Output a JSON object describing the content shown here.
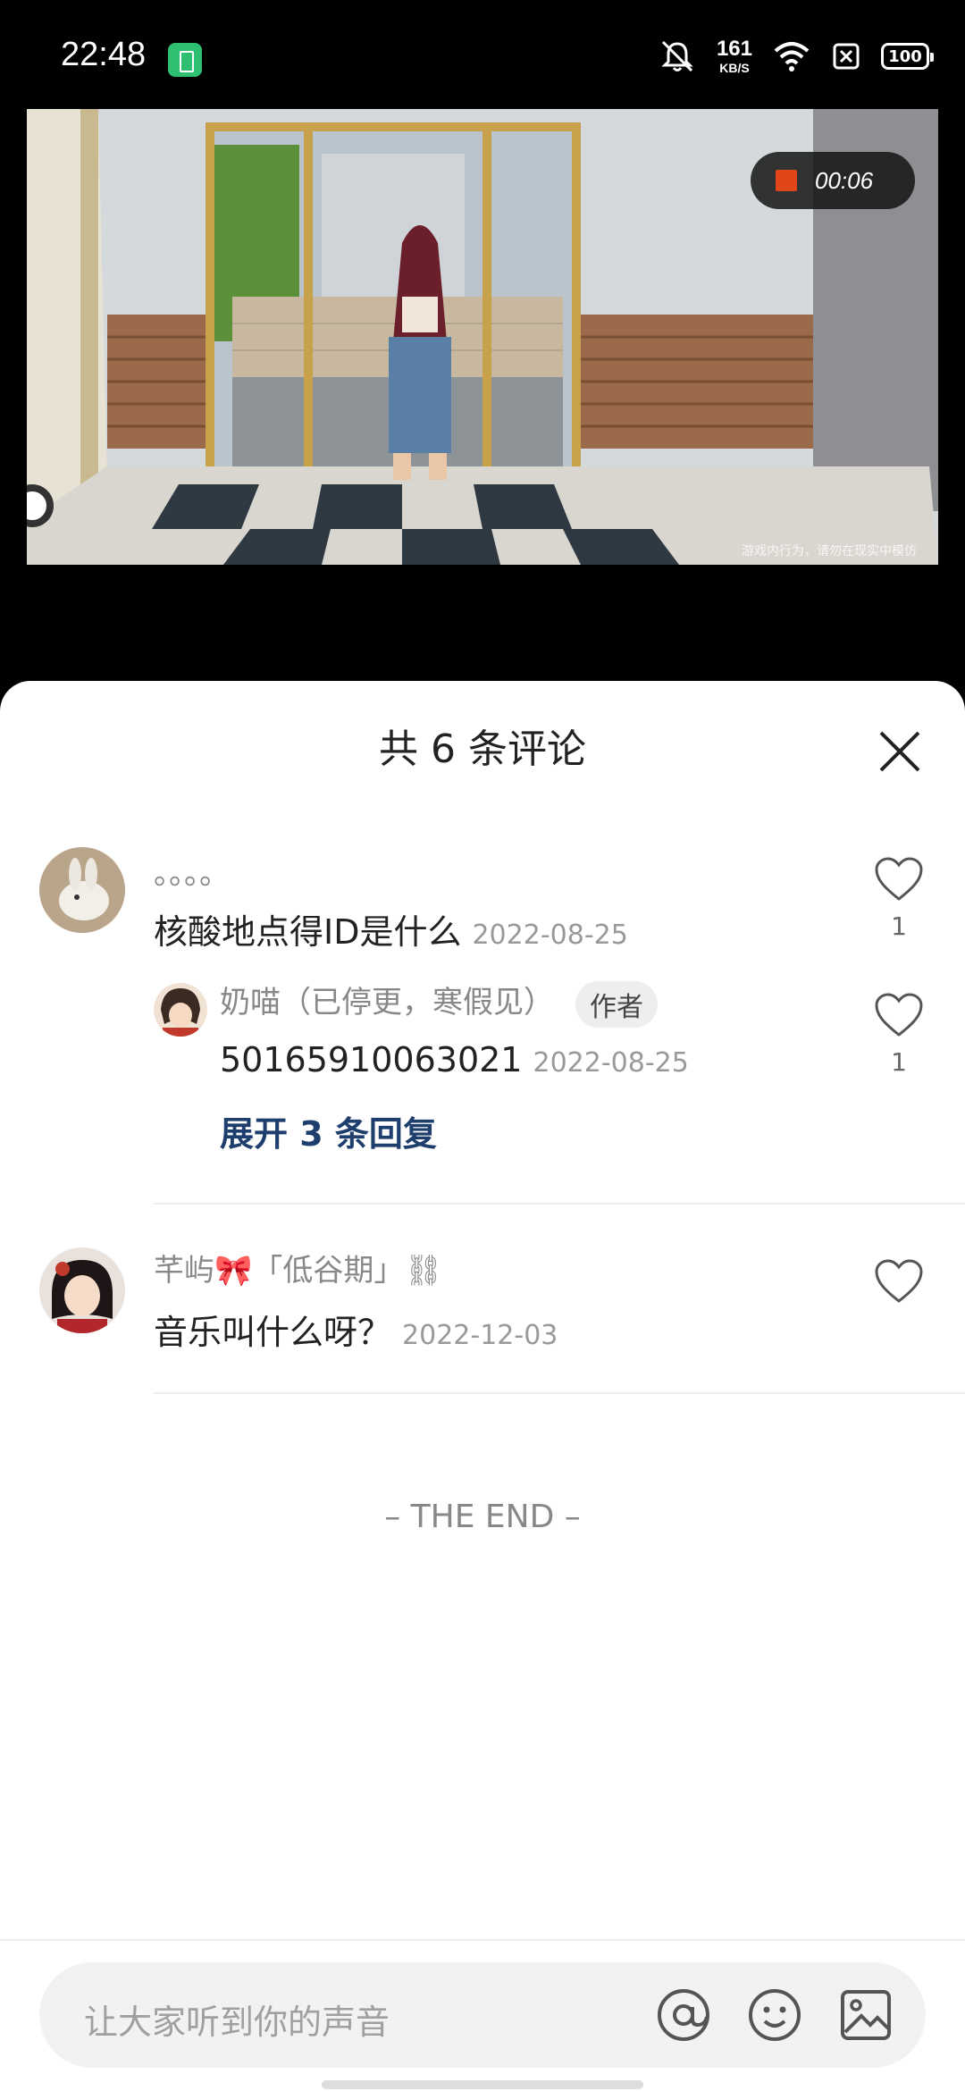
{
  "status_bar": {
    "time": "22:48",
    "net_speed_value": "161",
    "net_speed_unit": "KB/S",
    "battery": "100"
  },
  "video": {
    "recording_time": "00:06",
    "watermark": "游戏内行为，请勿在现实中模仿"
  },
  "comments_sheet": {
    "title": "共 6 条评论",
    "comments": [
      {
        "nickname": "。。。。",
        "text": "核酸地点得ID是什么",
        "date": "2022-08-25",
        "likes": "1",
        "reply": {
          "nickname": "奶喵（已停更，寒假见）",
          "author_tag": "作者",
          "text": "50165910063021",
          "date": "2022-08-25",
          "likes": "1"
        },
        "expand_label": "展开 3 条回复"
      },
      {
        "nickname": "芊屿🎀「低谷期」⛓",
        "text": "音乐叫什么呀？",
        "date": "2022-12-03",
        "likes": ""
      }
    ],
    "end_label": "– THE END –"
  },
  "input": {
    "placeholder": "让大家听到你的声音"
  },
  "colors": {
    "accent_link": "#1e3f6e",
    "record_dot": "#e0461a",
    "battery_app": "#2fbf71"
  }
}
